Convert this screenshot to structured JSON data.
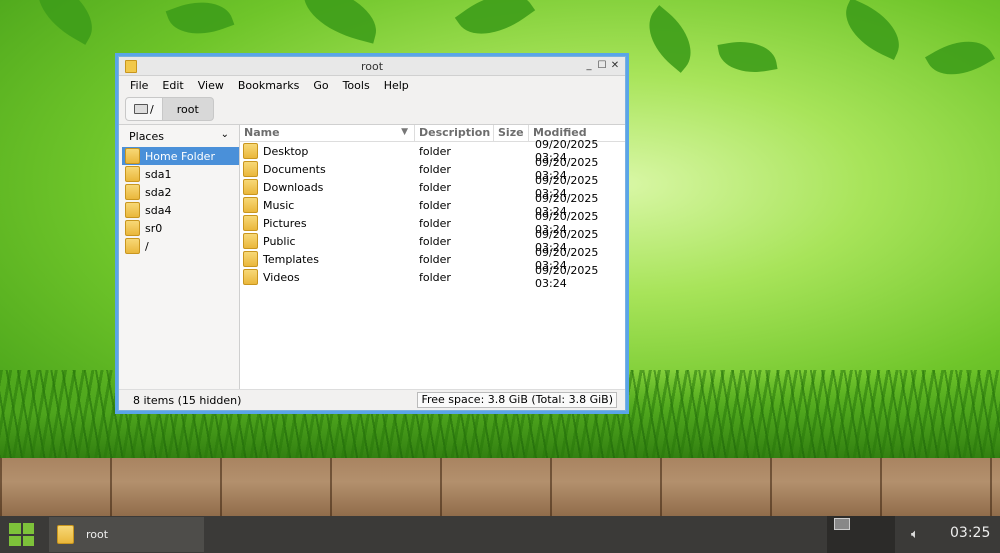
{
  "window": {
    "title": "root",
    "controls": {
      "minimize": "_",
      "maximize": "☐",
      "close": "✕"
    },
    "menu": [
      "File",
      "Edit",
      "View",
      "Bookmarks",
      "Go",
      "Tools",
      "Help"
    ],
    "path": {
      "root_label": "/",
      "current": "root"
    },
    "sidebar": {
      "header": "Places",
      "items": [
        {
          "label": "Home Folder",
          "selected": true
        },
        {
          "label": "sda1"
        },
        {
          "label": "sda2"
        },
        {
          "label": "sda4"
        },
        {
          "label": "sr0"
        },
        {
          "label": "/"
        }
      ]
    },
    "columns": {
      "name": "Name",
      "description": "Description",
      "size": "Size",
      "modified": "Modified"
    },
    "files": [
      {
        "name": "Desktop",
        "description": "folder",
        "size": "",
        "modified": "09/20/2025 03:24"
      },
      {
        "name": "Documents",
        "description": "folder",
        "size": "",
        "modified": "09/20/2025 03:24"
      },
      {
        "name": "Downloads",
        "description": "folder",
        "size": "",
        "modified": "09/20/2025 03:24"
      },
      {
        "name": "Music",
        "description": "folder",
        "size": "",
        "modified": "09/20/2025 03:24"
      },
      {
        "name": "Pictures",
        "description": "folder",
        "size": "",
        "modified": "09/20/2025 03:24"
      },
      {
        "name": "Public",
        "description": "folder",
        "size": "",
        "modified": "09/20/2025 03:24"
      },
      {
        "name": "Templates",
        "description": "folder",
        "size": "",
        "modified": "09/20/2025 03:24"
      },
      {
        "name": "Videos",
        "description": "folder",
        "size": "",
        "modified": "09/20/2025 03:24"
      }
    ],
    "status": {
      "items": "8 items (15 hidden)",
      "free_space": "Free space: 3.8 GiB (Total: 3.8 GiB)"
    }
  },
  "taskbar": {
    "task_label": "root",
    "clock": "03:25",
    "icons": {
      "start": "grid-menu-icon",
      "task": "folder-icon",
      "volume": "speaker-icon"
    },
    "accent": "#7ec23a"
  },
  "colors": {
    "selection": "#4a90d9",
    "window_border": "#5aa5e8",
    "taskbar": "#3b3a38"
  }
}
